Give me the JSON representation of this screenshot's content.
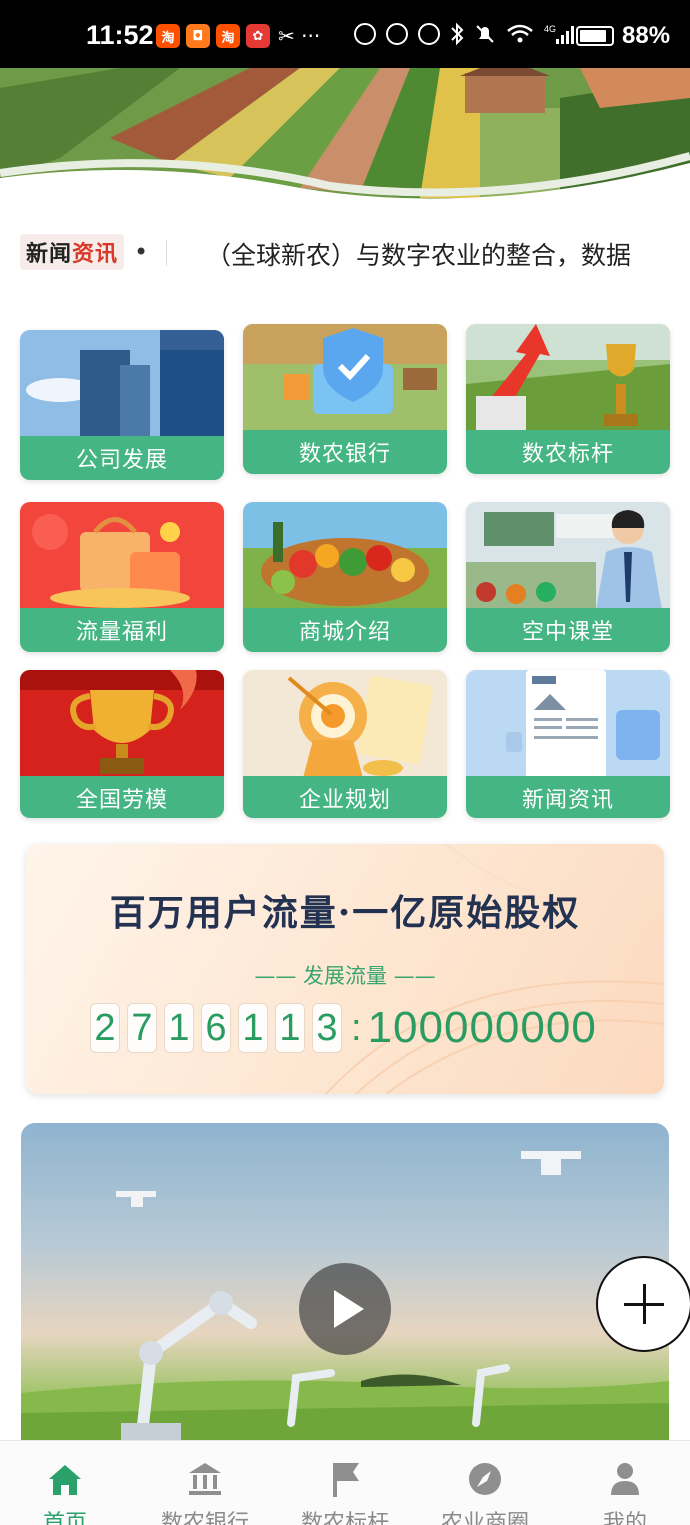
{
  "status_bar": {
    "time": "11:52",
    "app_icons": [
      "taobao-icon",
      "app-icon",
      "taobao-icon",
      "huawei-icon"
    ],
    "battery": "88%",
    "battery_level": 0.88,
    "network": "4G"
  },
  "ticker": {
    "badge_part1": "新闻",
    "badge_part2": "资讯",
    "dot": "•",
    "text": "（全球新农）与数字农业的整合，数据"
  },
  "menu": {
    "items": [
      {
        "label": "公司发展",
        "icon": "office-buildings-image"
      },
      {
        "label": "数农银行",
        "icon": "digital-bank-image"
      },
      {
        "label": "数农标杆",
        "icon": "benchmark-trophy-image"
      },
      {
        "label": "流量福利",
        "icon": "gift-bag-image"
      },
      {
        "label": "商城介绍",
        "icon": "fruit-basket-image"
      },
      {
        "label": "空中课堂",
        "icon": "online-class-image"
      },
      {
        "label": "全国劳模",
        "icon": "gold-trophy-image"
      },
      {
        "label": "企业规划",
        "icon": "target-plan-image"
      },
      {
        "label": "新闻资讯",
        "icon": "newspaper-image"
      }
    ]
  },
  "banner": {
    "title": "百万用户流量·一亿原始股权",
    "subtitle": "—— 发展流量 ——",
    "digits": [
      "2",
      "7",
      "1",
      "6",
      "1",
      "1",
      "3"
    ],
    "separator": ":",
    "total": "100000000"
  },
  "video": {
    "play_icon": "play-icon"
  },
  "fab": {
    "icon": "plus-icon"
  },
  "bottom_nav": {
    "items": [
      {
        "label": "首页",
        "icon": "home-icon",
        "active": true
      },
      {
        "label": "数农银行",
        "icon": "bank-icon",
        "active": false
      },
      {
        "label": "数农标杆",
        "icon": "flag-icon",
        "active": false
      },
      {
        "label": "农业商圈",
        "icon": "compass-icon",
        "active": false
      },
      {
        "label": "我的",
        "icon": "user-icon",
        "active": false
      }
    ]
  },
  "colors": {
    "accent_green": "#45b583",
    "active_nav": "#2aa06a",
    "inactive_nav": "#8a8a8a",
    "banner_title": "#243252",
    "badge_red": "#d83a2a"
  }
}
